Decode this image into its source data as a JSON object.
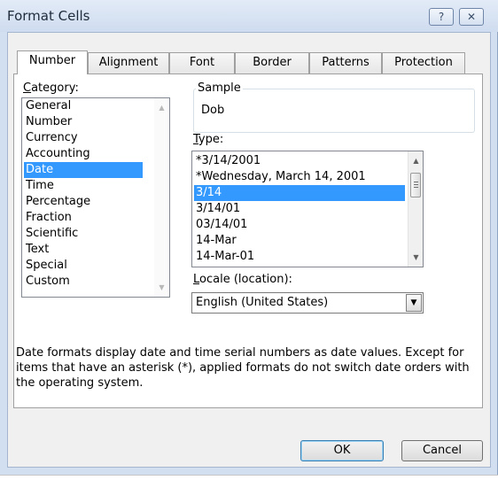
{
  "window": {
    "title": "Format Cells",
    "help_glyph": "?",
    "close_glyph": "✕"
  },
  "tabs": [
    {
      "label": "Number",
      "active": true
    },
    {
      "label": "Alignment"
    },
    {
      "label": "Font"
    },
    {
      "label": "Border"
    },
    {
      "label": "Patterns"
    },
    {
      "label": "Protection"
    }
  ],
  "category": {
    "label_mnemonic": "C",
    "label_rest": "ategory:",
    "items": [
      "General",
      "Number",
      "Currency",
      "Accounting",
      "Date",
      "Time",
      "Percentage",
      "Fraction",
      "Scientific",
      "Text",
      "Special",
      "Custom"
    ],
    "selected": "Date"
  },
  "sample": {
    "legend": "Sample",
    "value": "Dob"
  },
  "type": {
    "label_mnemonic": "T",
    "label_rest": "ype:",
    "items": [
      "*3/14/2001",
      "*Wednesday, March 14, 2001",
      "3/14",
      "3/14/01",
      "03/14/01",
      "14-Mar",
      "14-Mar-01"
    ],
    "selected": "3/14"
  },
  "locale": {
    "label_mnemonic": "L",
    "label_rest": "ocale (location):",
    "value": "English (United States)"
  },
  "description": "Date formats display date and time serial numbers as date values. Except for items that have an asterisk (*), applied formats do not switch date orders with the operating system.",
  "buttons": {
    "ok": "OK",
    "cancel": "Cancel"
  },
  "colors": {
    "selection": "#3399ff",
    "frame": "#d2dff0"
  }
}
